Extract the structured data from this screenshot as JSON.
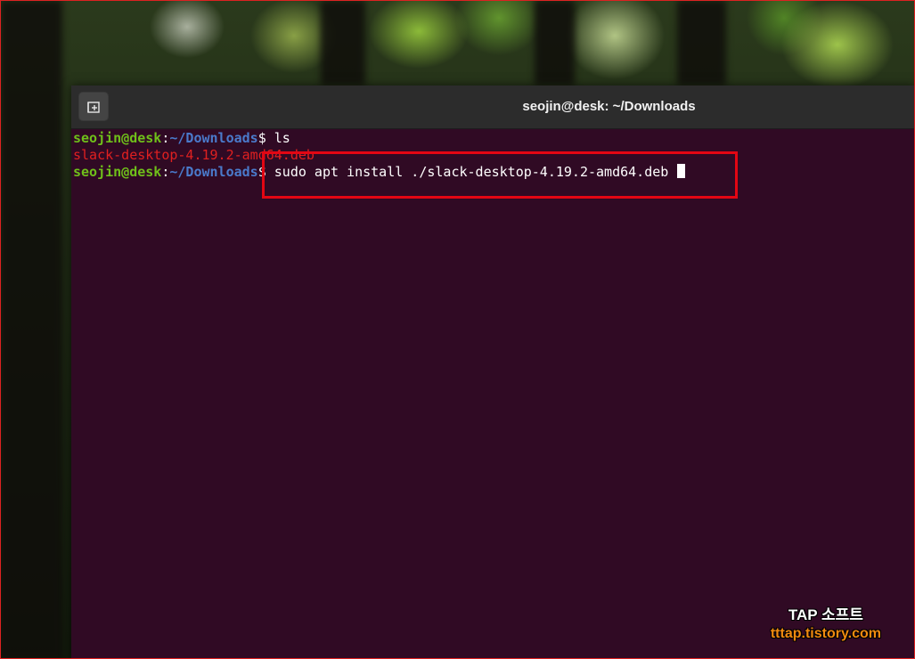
{
  "window": {
    "title": "seojin@desk: ~/Downloads",
    "new_tab_icon": "new-tab-icon"
  },
  "terminal": {
    "prompt_user": "seojin@desk",
    "prompt_colon": ":",
    "prompt_path": "~/Downloads",
    "prompt_symbol": "$ ",
    "lines": [
      {
        "command": "ls"
      },
      {
        "output": "slack-desktop-4.19.2-amd64.deb"
      },
      {
        "command": "sudo apt install ./slack-desktop-4.19.2-amd64.deb "
      }
    ],
    "colors": {
      "background": "#300a24",
      "user": "#6fbf1a",
      "path": "#4a7acb",
      "file": "#e02020"
    }
  },
  "annotation": {
    "highlight_color": "#e30613"
  },
  "watermark": {
    "brand": "TAP 소프트",
    "url": "tttap.tistory.com"
  }
}
